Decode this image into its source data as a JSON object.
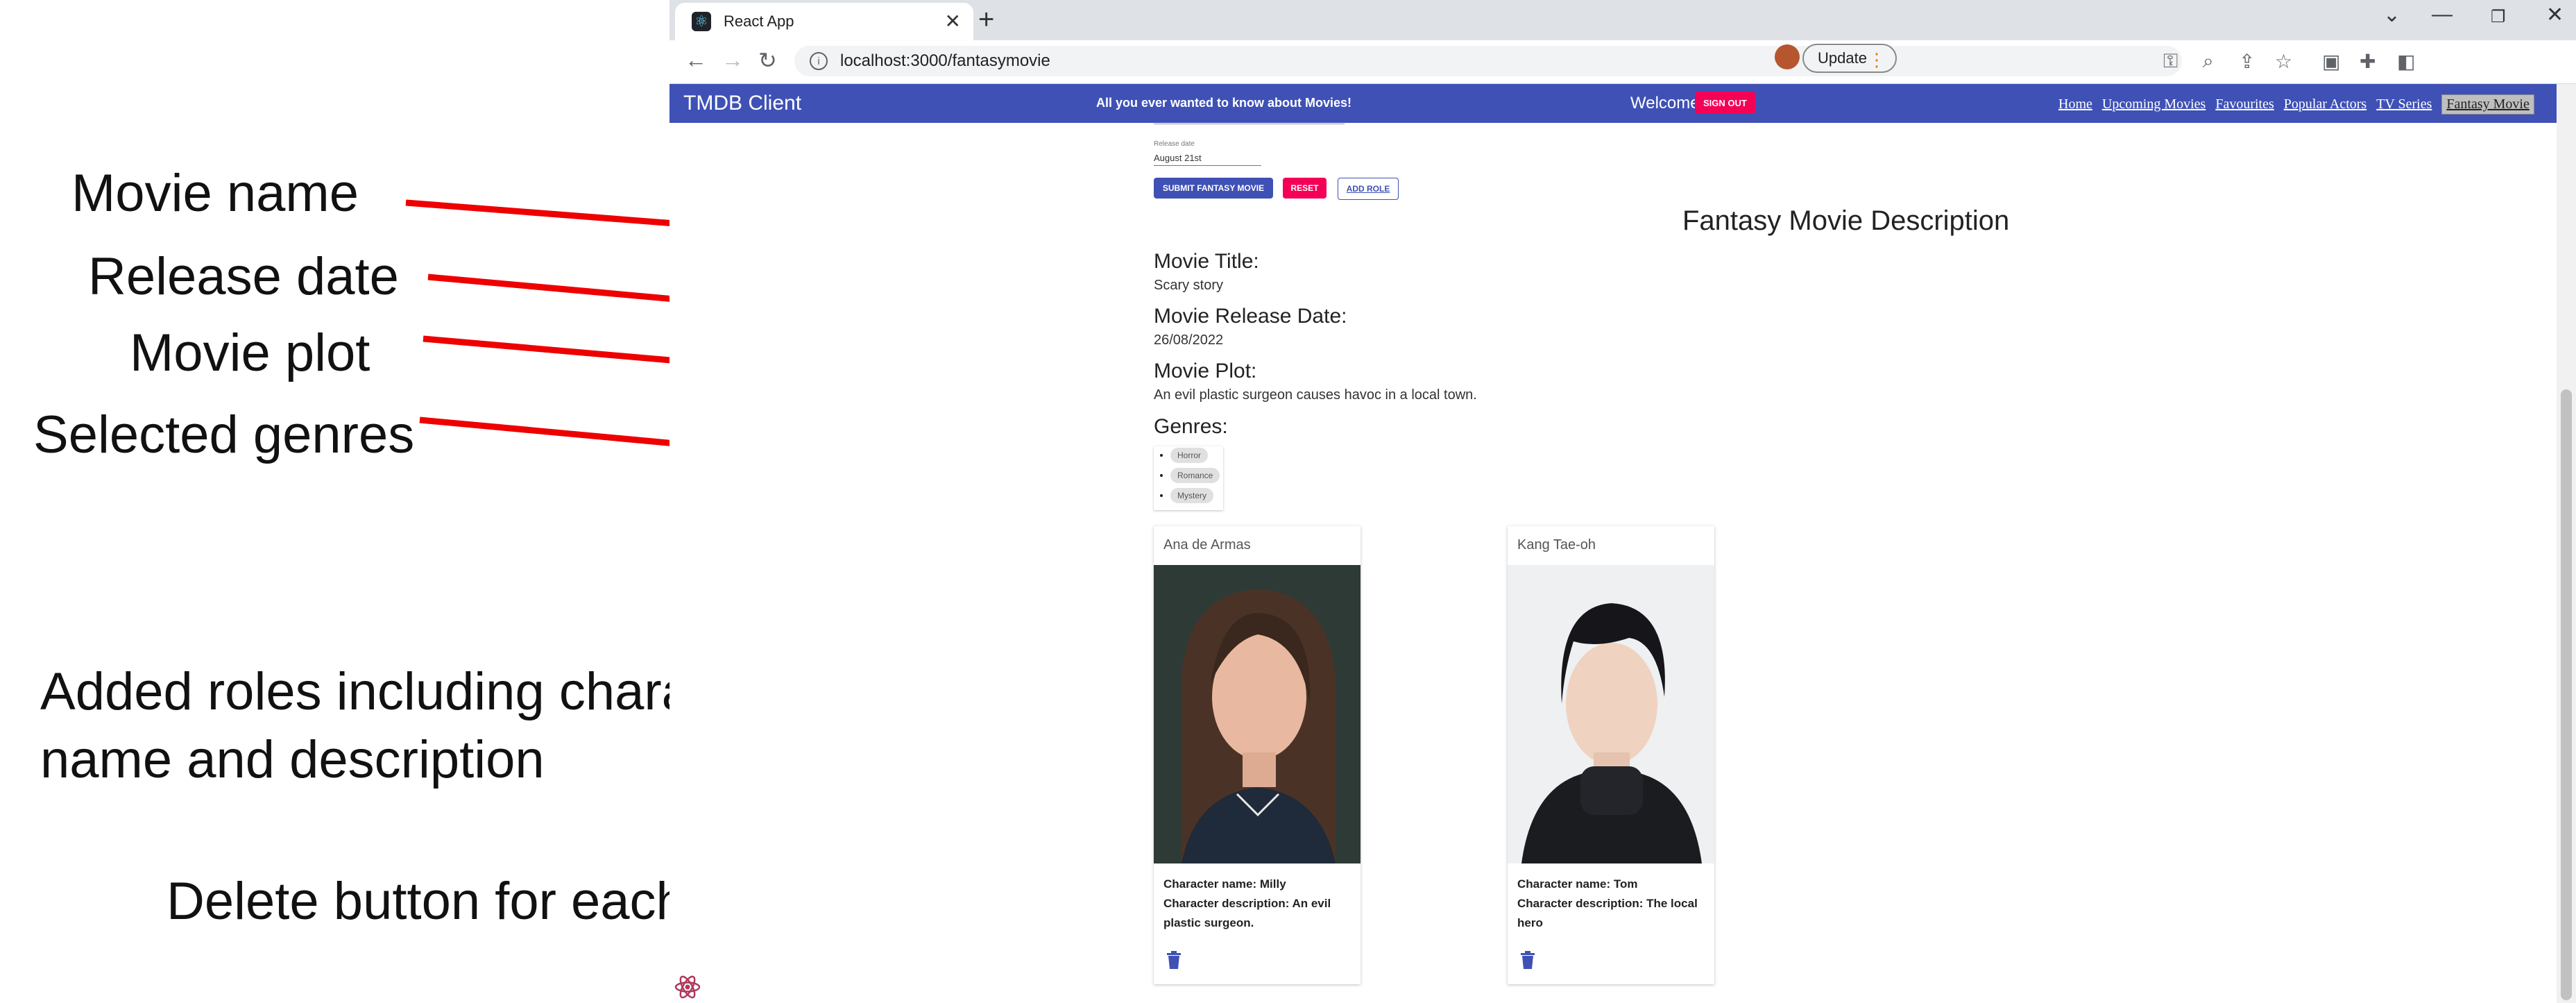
{
  "annotations": {
    "movie_name": "Movie name",
    "release_date": "Release date",
    "movie_plot": "Movie plot",
    "selected_genres": "Selected genres",
    "added_roles_line1": "Added roles including character",
    "added_roles_line2": "name and description",
    "delete_button": "Delete button for each role",
    "line_color": "#ee0000"
  },
  "browser": {
    "tab_title": "React App",
    "url": "localhost:3000/fantasymovie",
    "update_label": "Update"
  },
  "appbar": {
    "brand": "TMDB Client",
    "tagline": "All you ever wanted to know about Movies!",
    "welcome": "Welcome!",
    "sign_out": "SIGN OUT",
    "nav": [
      "Home",
      "Upcoming Movies",
      "Favourites",
      "Popular Actors",
      "TV Series",
      "Fantasy Movie"
    ],
    "color": "#3f51b5"
  },
  "form": {
    "release_label": "Release date",
    "release_value": "August 21st",
    "submit": "SUBMIT FANTASY MOVIE",
    "reset": "RESET",
    "add_role": "ADD ROLE"
  },
  "description": {
    "title": "Fantasy Movie Description",
    "movie_title_label": "Movie Title:",
    "movie_title": "Scary story",
    "release_label": "Movie Release Date:",
    "release_date": "26/08/2022",
    "plot_label": "Movie Plot:",
    "plot": "An evil plastic surgeon causes havoc in a local town.",
    "genres_label": "Genres:",
    "genres": [
      "Horror",
      "Romance",
      "Mystery"
    ]
  },
  "roles": [
    {
      "actor": "Ana de Armas",
      "character_name": "Character name: Milly",
      "character_description": "Character description: An evil plastic surgeon."
    },
    {
      "actor": "Kang Tae-oh",
      "character_name": "Character name: Tom",
      "character_description": "Character description: The local hero"
    }
  ]
}
